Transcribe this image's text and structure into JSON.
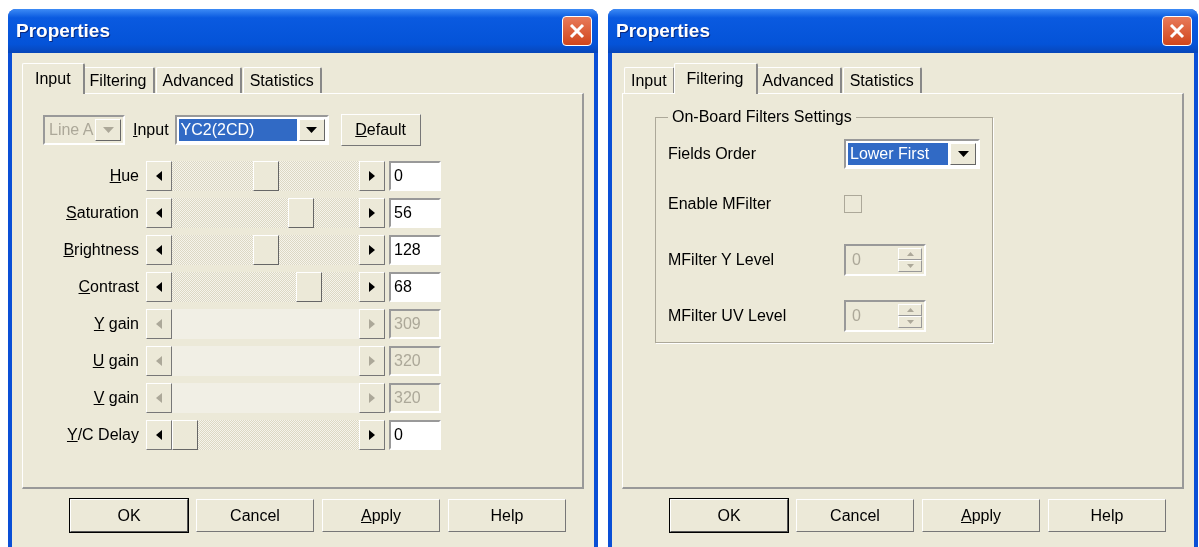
{
  "windows": [
    {
      "title": "Properties",
      "tabs": [
        {
          "label": "Input",
          "selected": true
        },
        {
          "label": "Filtering",
          "selected": false
        },
        {
          "label": "Advanced",
          "selected": false
        },
        {
          "label": "Statistics",
          "selected": false
        }
      ],
      "panel": {
        "kind": "input",
        "line_select": {
          "value": "Line A",
          "disabled": true
        },
        "input_label": {
          "key": "I",
          "rest": "nput"
        },
        "input_select": {
          "value": "YC2(2CD)",
          "highlighted": true
        },
        "default_button": {
          "key": "D",
          "rest": "efault"
        },
        "sliders": [
          {
            "key": "H",
            "rest": "ue",
            "level": 0.5,
            "value": "0",
            "disabled": false
          },
          {
            "key": "S",
            "rest": "aturation",
            "level": 0.72,
            "value": "56",
            "disabled": false
          },
          {
            "key": "B",
            "rest": "rightness",
            "level": 0.5,
            "value": "128",
            "disabled": false
          },
          {
            "key": "C",
            "rest": "ontrast",
            "level": 0.77,
            "value": "68",
            "disabled": false
          },
          {
            "key": "Y",
            "rest": " gain",
            "value": "309",
            "disabled": true
          },
          {
            "key": "U",
            "rest": " gain",
            "value": "320",
            "disabled": true
          },
          {
            "key": "V",
            "rest": " gain",
            "value": "320",
            "disabled": true
          },
          {
            "key": "Y",
            "rest": "/C Delay",
            "level": 0,
            "value": "0",
            "disabled": false
          }
        ]
      },
      "buttons": [
        {
          "label": "OK",
          "default": true
        },
        {
          "label": "Cancel",
          "default": false
        },
        {
          "key": "A",
          "rest": "pply",
          "default": false
        },
        {
          "label": "Help",
          "default": false
        }
      ]
    },
    {
      "title": "Properties",
      "tabs": [
        {
          "label": "Input",
          "selected": false
        },
        {
          "label": "Filtering",
          "selected": true
        },
        {
          "label": "Advanced",
          "selected": false
        },
        {
          "label": "Statistics",
          "selected": false
        }
      ],
      "panel": {
        "kind": "filtering",
        "group_title": "On-Board Filters Settings",
        "rows": [
          {
            "kind": "select",
            "label": "Fields Order",
            "value": "Lower First",
            "highlighted": true
          },
          {
            "kind": "checkbox",
            "label": "Enable MFilter",
            "checked": false
          },
          {
            "kind": "spin",
            "label": "MFilter Y Level",
            "value": "0",
            "disabled": true
          },
          {
            "kind": "spin",
            "label": "MFilter UV Level",
            "value": "0",
            "disabled": true
          }
        ]
      },
      "buttons": [
        {
          "label": "OK",
          "default": true
        },
        {
          "label": "Cancel",
          "default": false
        },
        {
          "key": "A",
          "rest": "pply",
          "default": false
        },
        {
          "label": "Help",
          "default": false
        }
      ]
    }
  ]
}
